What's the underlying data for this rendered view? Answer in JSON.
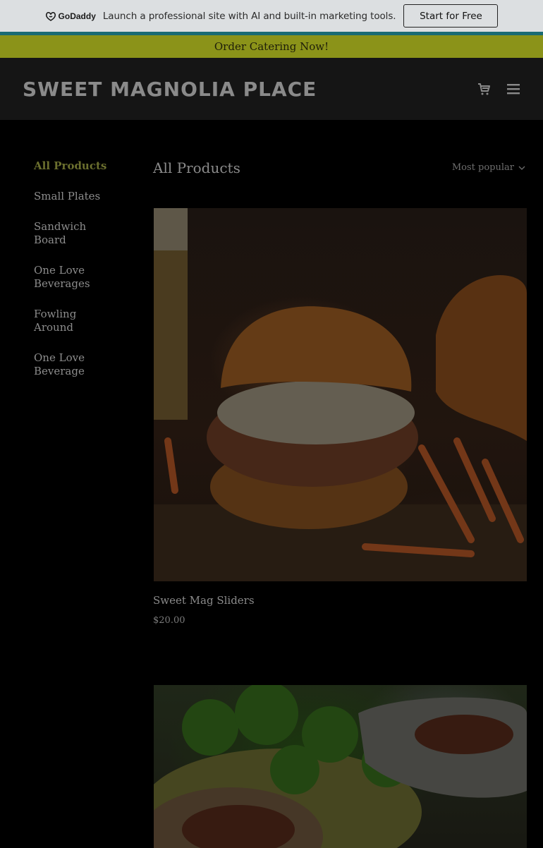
{
  "promo": {
    "logo_text": "GoDaddy",
    "message": "Launch a professional site with AI and built-in marketing tools.",
    "cta_label": "Start for Free"
  },
  "banner": {
    "text": "Order Catering Now!"
  },
  "header": {
    "site_title": "SWEET MAGNOLIA PLACE",
    "icons": [
      "cart-icon",
      "menu-icon"
    ]
  },
  "sidebar": {
    "categories": [
      {
        "label": "All Products",
        "active": true
      },
      {
        "label": "Small Plates",
        "active": false
      },
      {
        "label": "Sandwich Board",
        "active": false
      },
      {
        "label": "One Love Beverages",
        "active": false
      },
      {
        "label": "Fowling Around",
        "active": false
      },
      {
        "label": "One Love Beverage",
        "active": false
      }
    ]
  },
  "main": {
    "title": "All Products",
    "sort_label": "Most popular",
    "products": [
      {
        "name": "Sweet Mag Sliders",
        "price": "$20.00"
      },
      {
        "name": "",
        "price": ""
      }
    ]
  },
  "colors": {
    "promo_bg": "#dcdfe1",
    "teal_accent": "#1a6b73",
    "banner_bg": "#8b9319",
    "header_bg": "#151515",
    "active_category": "#6b6f2e"
  }
}
